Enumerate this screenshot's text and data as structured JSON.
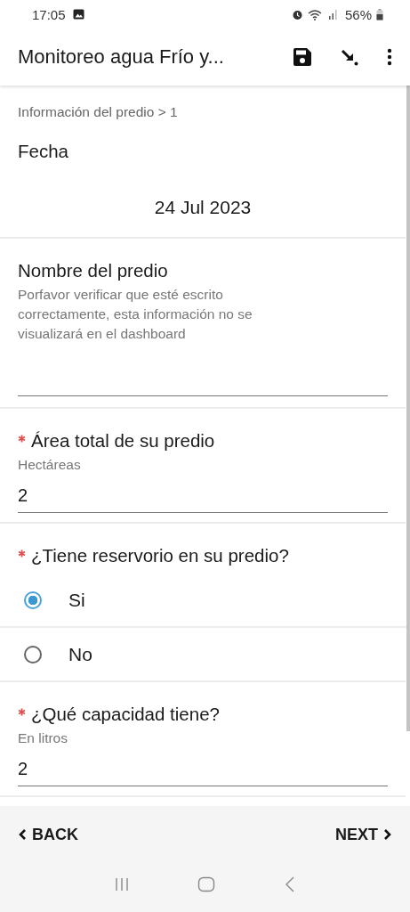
{
  "status_bar": {
    "time": "17:05",
    "battery": "56%"
  },
  "app_bar": {
    "title": "Monitoreo agua Frío y..."
  },
  "breadcrumb": "Información del predio > 1",
  "questions": [
    {
      "kind": "date",
      "label": "Fecha",
      "required": false,
      "value": "24 Jul 2023"
    },
    {
      "kind": "text",
      "label": "Nombre del predio",
      "required": false,
      "hint": "Porfavor verificar que esté escrito correctamente, esta información no se visualizará en el dashboard"
    },
    {
      "kind": "number",
      "label": "Área total de su predio",
      "required": true,
      "hint": "Hectáreas",
      "value": "2"
    },
    {
      "kind": "radio",
      "label": "¿Tiene reservorio en su predio?",
      "required": true,
      "options": [
        {
          "label": "Si",
          "selected": true
        },
        {
          "label": "No",
          "selected": false
        }
      ]
    },
    {
      "kind": "number",
      "label": "¿Qué capacidad tiene?",
      "required": true,
      "hint": "En litros",
      "value": "2"
    }
  ],
  "footer": {
    "back": "BACK",
    "next": "NEXT"
  }
}
